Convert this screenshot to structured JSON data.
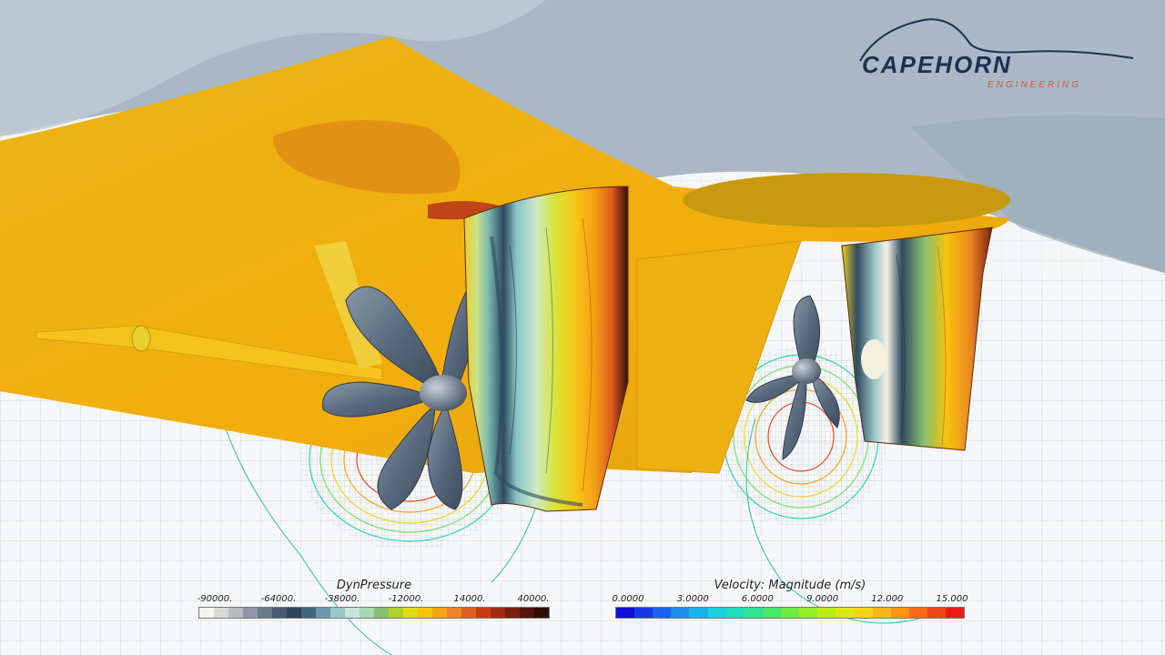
{
  "logo": {
    "brand_part1": "CAPE",
    "brand_part2": "HORN",
    "subtitle": "ENGINEERING",
    "brand_color": "#1e3050",
    "accent_color": "#d45a3a"
  },
  "legend_pressure": {
    "title": "DynPressure",
    "ticks": [
      "-90000.",
      "-64000.",
      "-38000.",
      "-12000.",
      "14000.",
      "40000."
    ],
    "colors": [
      "#f4f4f0",
      "#d8dcd8",
      "#b6bcc0",
      "#8e98a4",
      "#67788a",
      "#465a70",
      "#2f4458",
      "#3e6680",
      "#6a9aa8",
      "#9cc8c8",
      "#c6e6dc",
      "#a6d8b2",
      "#88c070",
      "#b2d02e",
      "#e2dc14",
      "#f6c40c",
      "#f4a414",
      "#ec8424",
      "#de5e1e",
      "#c63e12",
      "#a22a0e",
      "#7a1e10",
      "#52140c",
      "#2e0c08"
    ]
  },
  "legend_velocity": {
    "title": "Velocity: Magnitude (m/s)",
    "ticks": [
      "0.0000",
      "3.0000",
      "6.0000",
      "9.0000",
      "12.000",
      "15.000"
    ],
    "colors": [
      "#1010d8",
      "#1838e8",
      "#1c62f0",
      "#1c8cf0",
      "#18b2ec",
      "#18d0e0",
      "#1edcbc",
      "#2ce494",
      "#44e86a",
      "#6aec44",
      "#94ee28",
      "#baec18",
      "#dce614",
      "#f4d414",
      "#fcb814",
      "#fc9414",
      "#f86c14",
      "#f04414",
      "#e81c14"
    ]
  }
}
